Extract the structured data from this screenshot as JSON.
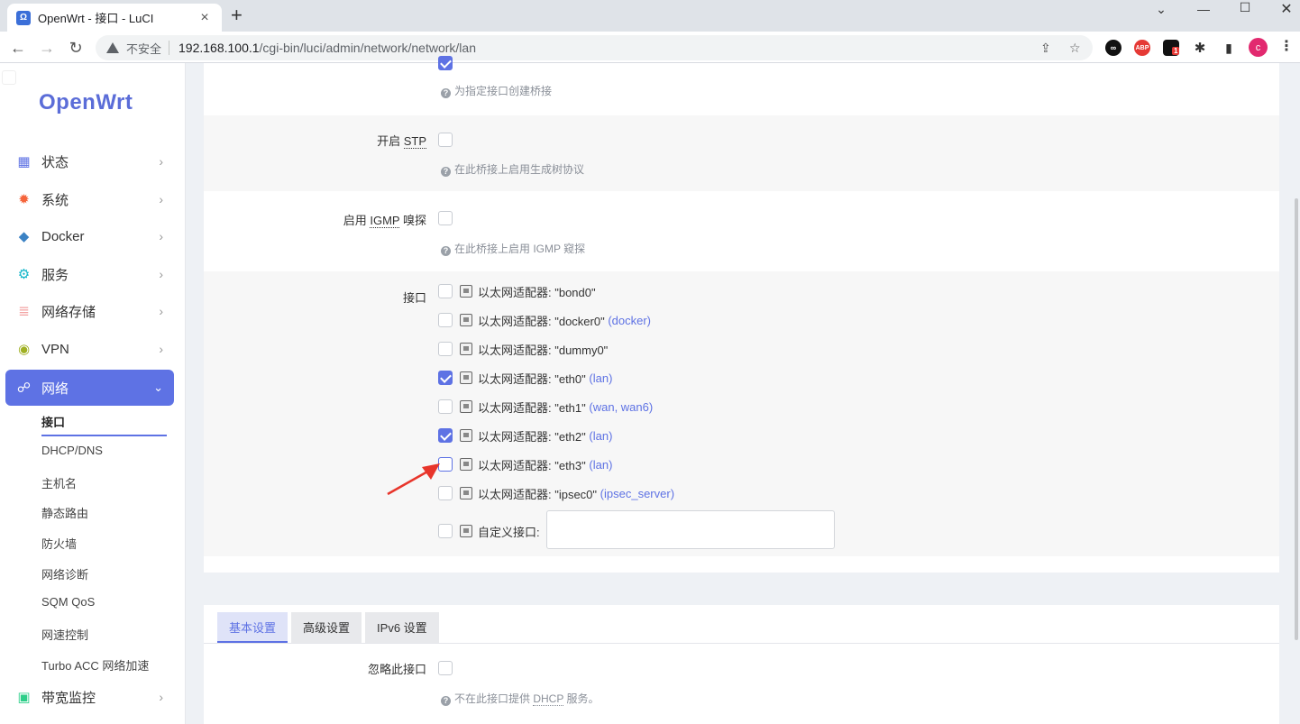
{
  "browser": {
    "tab_title": "OpenWrt - 接口 - LuCI",
    "tab_favicon": "Ω",
    "insecure_label": "不安全",
    "url_host": "192.168.100.1",
    "url_path": "/cgi-bin/luci/admin/network/network/lan",
    "profile_initial": "c",
    "ext_abp": "ABP",
    "ext_badge": "1"
  },
  "sidebar": {
    "logo": "OpenWrt",
    "items": [
      {
        "label": "状态",
        "icon": "dashboard-icon"
      },
      {
        "label": "系统",
        "icon": "gear-icon"
      },
      {
        "label": "Docker",
        "icon": "docker-icon"
      },
      {
        "label": "服务",
        "icon": "services-icon"
      },
      {
        "label": "网络存储",
        "icon": "database-icon"
      },
      {
        "label": "VPN",
        "icon": "globe-icon"
      },
      {
        "label": "网络",
        "icon": "sitemap-icon"
      }
    ],
    "sub_items": [
      "接口",
      "DHCP/DNS",
      "主机名",
      "静态路由",
      "防火墙",
      "网络诊断",
      "SQM QoS",
      "网速控制",
      "Turbo ACC 网络加速"
    ],
    "bottom_item": {
      "label": "带宽监控",
      "icon": "monitor-icon"
    }
  },
  "form": {
    "bridge_hint": "为指定接口创建桥接",
    "stp_label_prefix": "开启 ",
    "stp_label_abbr": "STP",
    "stp_hint": "在此桥接上启用生成树协议",
    "igmp_label_prefix": "启用 ",
    "igmp_label_abbr": "IGMP",
    "igmp_label_suffix": " 嗅探",
    "igmp_hint": "在此桥接上启用 IGMP 窥探",
    "interface_label": "接口",
    "interfaces": [
      {
        "text": "以太网适配器: \"bond0\"",
        "zone": "",
        "checked": false
      },
      {
        "text": "以太网适配器: \"docker0\"",
        "zone": "(docker)",
        "checked": false
      },
      {
        "text": "以太网适配器: \"dummy0\"",
        "zone": "",
        "checked": false
      },
      {
        "text": "以太网适配器: \"eth0\"",
        "zone": "(lan)",
        "checked": true
      },
      {
        "text": "以太网适配器: \"eth1\"",
        "zone": "(wan, wan6)",
        "checked": false
      },
      {
        "text": "以太网适配器: \"eth2\"",
        "zone": "(lan)",
        "checked": true
      },
      {
        "text": "以太网适配器: \"eth3\"",
        "zone": "(lan)",
        "checked": false
      },
      {
        "text": "以太网适配器: \"ipsec0\"",
        "zone": "(ipsec_server)",
        "checked": false
      }
    ],
    "custom_label": "自定义接口:"
  },
  "dhcp": {
    "tabs": [
      "基本设置",
      "高级设置",
      "IPv6 设置"
    ],
    "ignore_label": "忽略此接口",
    "ignore_hint_prefix": "不在此接口提供 ",
    "ignore_hint_abbr": "DHCP",
    "ignore_hint_suffix": " 服务。"
  }
}
